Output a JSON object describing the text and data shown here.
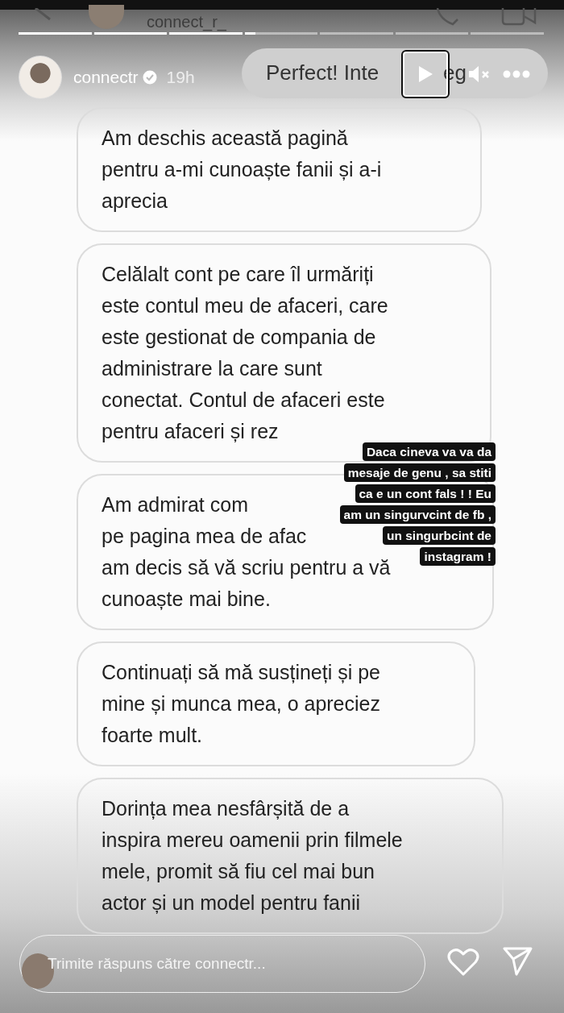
{
  "chat_header": {
    "name": "connect_r_"
  },
  "progress": [
    {
      "viewed": true
    },
    {
      "viewed": true
    },
    {
      "viewed": true
    },
    {
      "viewed": false,
      "level": 0.15
    },
    {
      "viewed": false
    },
    {
      "viewed": false
    },
    {
      "viewed": false
    }
  ],
  "story_header": {
    "username": "connectr",
    "verified": true,
    "time": "19h",
    "paused": true,
    "muted": true
  },
  "background_bubble": {
    "text_before": "Perfect! Inte",
    "text_after": "eg"
  },
  "messages": [
    {
      "lines": [
        "Am deschis această pagină",
        "pentru a-mi cunoaște fanii și a-i",
        "aprecia"
      ]
    },
    {
      "lines": [
        "Celălalt cont pe care îl urmăriți",
        "este contul meu de afaceri, care",
        "este gestionat de compania de",
        "administrare la care sunt",
        "conectat.  Contul de afaceri este",
        "pentru afaceri și rez"
      ]
    },
    {
      "lines": [
        "Am admirat com",
        "pe pagina mea de afac",
        "am decis să vă scriu pentru a vă",
        "cunoaște mai bine."
      ]
    },
    {
      "lines": [
        "Continuați să mă susțineți și pe",
        "mine și munca mea, o apreciez",
        "foarte mult."
      ]
    },
    {
      "lines": [
        "Dorința mea nesfârșită de a",
        "inspira mereu oamenii prin filmele",
        "mele, promit să fiu cel mai bun",
        "actor și un model pentru fanii"
      ]
    }
  ],
  "sticker": {
    "lines": [
      "Daca  cineva va va da",
      "mesaje de genu , sa stiti",
      "ca e un cont fals ! ! Eu",
      "am un singurvcint de fb ,",
      "un singurbcint de",
      "instagram !"
    ]
  },
  "reply": {
    "placeholder": "Trimite răspuns către connectr..."
  }
}
